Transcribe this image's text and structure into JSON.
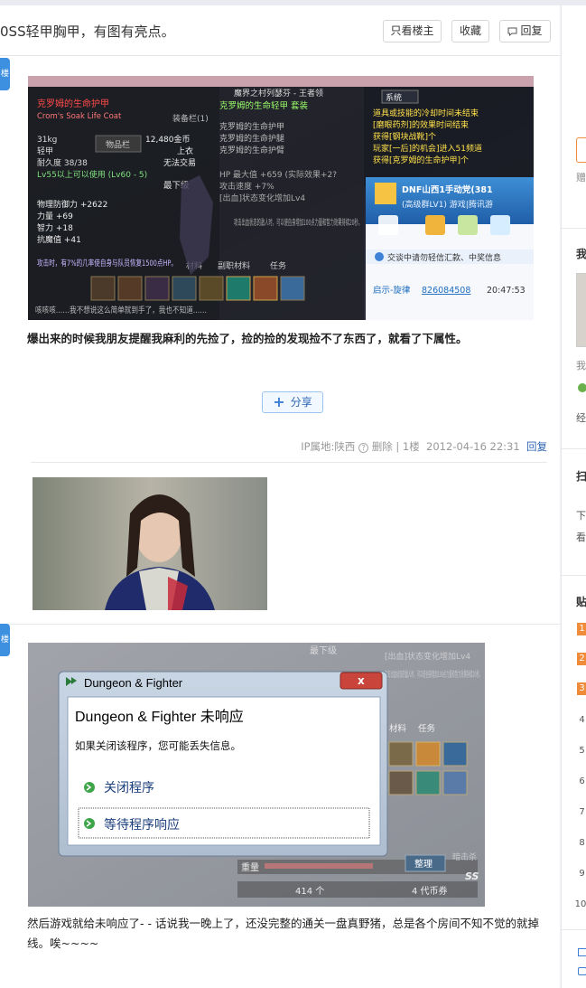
{
  "thread": {
    "title": "0SS轻甲胸甲，有图有亮点。",
    "buttons": {
      "only_op": "只看楼主",
      "favorite": "收藏",
      "reply": "回复"
    }
  },
  "post1": {
    "floor_badge": "楼",
    "screenshot": {
      "item_name": "克罗姆的生命护甲",
      "item_name_en": "Crom's Soak Life Coat",
      "weight": "31kg",
      "type": "轻甲",
      "durability": "耐久度 38/38",
      "level_req": "Lv55以上可以使用 (Lv60 - 5)",
      "inventory_tab": "物品栏",
      "equip_tab": "装备栏(1)",
      "gold": "12,480金币",
      "slot": "上衣",
      "trade": "无法交易",
      "grade": "最下级",
      "phys_def": "物理防御力 +2622",
      "str": "力量 +69",
      "int": "智力 +18",
      "magic_res": "抗魔值 +41",
      "effect_text": "攻击时，有7%的几率使自身与队员恢复1500点HP。",
      "mat_tab": "材料",
      "sub_mat_tab": "副职材料",
      "quest_tab": "任务",
      "set_name": "克罗姆的生命轻甲 套装",
      "set_item1": "克罗姆的生命护甲",
      "set_item2": "克罗姆的生命护腿",
      "set_item3": "克罗姆的生命护臂",
      "set_hp": "HP 最大值 +659 (实际效果+2?",
      "set_speed": "攻击速度 +7%",
      "set_buff": "[出血]状态变化增加Lv4",
      "set_desc": "攻击出血状态的敌人时，可以使自身增加100点力量和智力效果持续20秒。",
      "top_text": "魔界之村列瑟芬 - 王者领",
      "sys_tab": "系统",
      "sys_msg1": "道具或技能的冷却时间未结束",
      "sys_msg2": "[磨眼药剂]的效果时间结束",
      "sys_msg3": "获得[钢块战靴]个",
      "sys_msg4": "玩家[一后]的机会]进入51频道",
      "sys_msg5": "获得[克罗姆的生命护甲]个",
      "chat_group": "DNF山西1手动党(381",
      "chat_level": "(高级群LV1) 游戏|腾讯游",
      "chat_notice": "交谈中请勿轻信汇款、中奖信息",
      "chat_user": "启示-旋律",
      "chat_qq": "826084508",
      "chat_time": "20:47:53",
      "bottom_text": "咳咳咳……我不想说这么简单就到手了，我也不知道……"
    },
    "text": "爆出来的时候我朋友提醒我麻利的先捡了，捡的捡的发现捡不了东西了，就看了下属性。",
    "share": "分享",
    "meta": {
      "ip": "IP属地:陕西",
      "delete": "删除",
      "floor": "1楼",
      "time": "2012-04-16 22:31",
      "reply": "回复"
    }
  },
  "post2": {
    "floor_badge": "楼",
    "dialog": {
      "window_title": "Dungeon & Fighter",
      "heading": "Dungeon & Fighter 未响应",
      "message": "如果关闭该程序，您可能丢失信息。",
      "option_close": "关闭程序",
      "option_wait": "等待程序响应",
      "close_x": "x"
    },
    "background": {
      "grade": "最下级",
      "buff": "[出血]状态变化增加Lv4",
      "desc": "攻击出血状态的敌人时，可以使自身增加100点力量和智力效果持续20秒。",
      "mat": "材料",
      "quest": "任务",
      "weight": "重量",
      "organize": "整理",
      "count": "414 个",
      "coupon": "4 代币券",
      "ss": "SS",
      "skill_hint": "暗击杀"
    },
    "text": "然后游戏就给未响应了- - 话说我一晚上了，还没完整的通关一盘真野猪，总是各个房间不知不觉的就掉线。唉~~~~"
  },
  "sidebar": {
    "frag_gift": "赠",
    "frag_me": "我",
    "frag_me2": "我",
    "frag_jing": "经",
    "frag_sao": "扫",
    "frag_xia": "下",
    "frag_kan": "看",
    "frag_tie": "贴",
    "ranks": [
      "1",
      "2",
      "3",
      "4",
      "5",
      "6",
      "7",
      "8",
      "9",
      "10"
    ]
  },
  "colors": {
    "accent": "#3d8fe0",
    "link": "#2d64b3",
    "hot_rank": "#f08b3a"
  }
}
